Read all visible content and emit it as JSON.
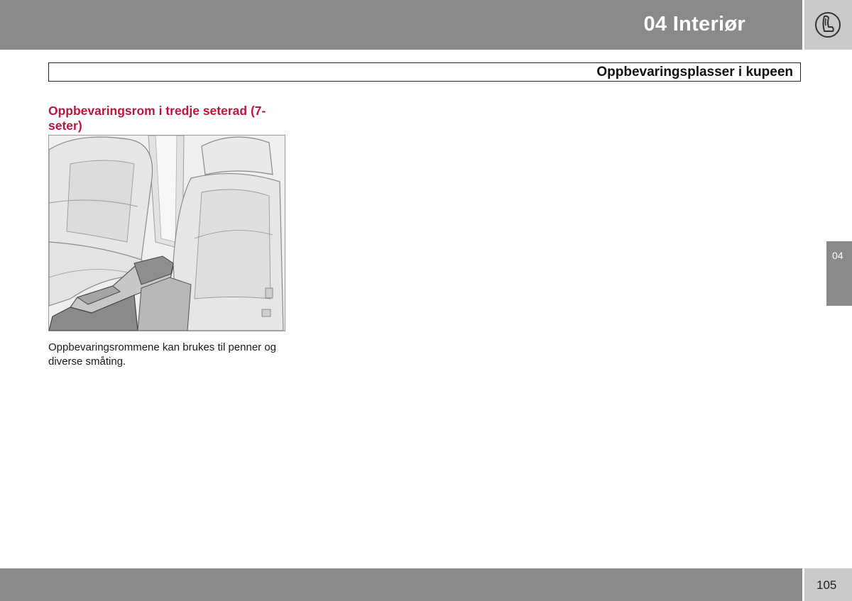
{
  "header": {
    "chapter_title": "04 Interiør",
    "chapter_icon": "seat-icon"
  },
  "section": {
    "title": "Oppbevaringsplasser i kupeen"
  },
  "content": {
    "subheading": "Oppbevaringsrom i tredje seterad (7-seter)",
    "figure_icon": "seat-storage-illustration",
    "body": "Oppbevaringsrommene kan brukes til penner og diverse småting."
  },
  "side_tab": {
    "label": "04"
  },
  "footer": {
    "page_number": "105"
  },
  "colors": {
    "bar_gray": "#898a8c",
    "light_gray": "#c9cacb",
    "heading_red": "#b8173f"
  }
}
